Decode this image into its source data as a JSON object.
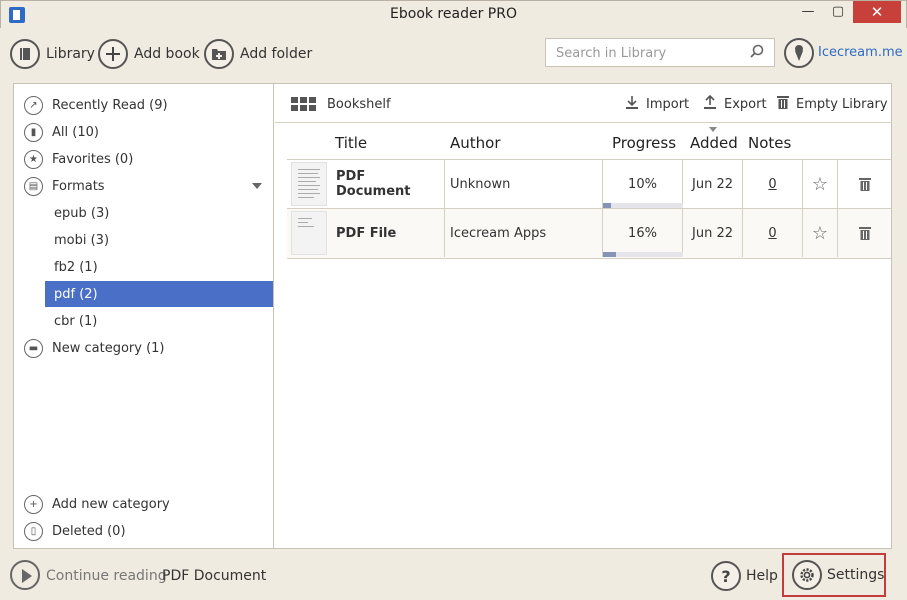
{
  "window": {
    "title": "Ebook reader PRO",
    "min_glyph": "—",
    "max_glyph": "▢",
    "close_glyph": "✕"
  },
  "toolbar": {
    "library_label": "Library",
    "add_book_label": "Add book",
    "add_folder_label": "Add folder",
    "search_placeholder": "Search in Library",
    "brand_link": "Icecream.me"
  },
  "sidebar": {
    "items": [
      {
        "label": "Recently Read (9)",
        "icon": "recently-read-icon"
      },
      {
        "label": "All (10)",
        "icon": "books-icon"
      },
      {
        "label": "Favorites (0)",
        "icon": "star-icon"
      },
      {
        "label": "Formats",
        "icon": "file-icon"
      }
    ],
    "formats": [
      {
        "label": "epub (3)"
      },
      {
        "label": "mobi (3)"
      },
      {
        "label": "fb2 (1)"
      },
      {
        "label": "pdf (2)",
        "selected": true
      },
      {
        "label": "cbr (1)"
      }
    ],
    "category": {
      "label": "New category (1)",
      "icon": "folder-icon"
    },
    "add_category": "Add new category",
    "deleted": "Deleted (0)"
  },
  "content": {
    "view_label": "Bookshelf",
    "actions": {
      "import": "Import",
      "export": "Export",
      "empty": "Empty Library"
    },
    "columns": {
      "title": "Title",
      "author": "Author",
      "progress": "Progress",
      "added": "Added",
      "notes": "Notes"
    },
    "books": [
      {
        "title": "PDF Document",
        "author": "Unknown",
        "progress": "10%",
        "progress_value": 0.1,
        "added": "Jun 22",
        "notes": "0"
      },
      {
        "title": "PDF File",
        "author": "Icecream Apps",
        "progress": "16%",
        "progress_value": 0.16,
        "added": "Jun 22",
        "notes": "0"
      }
    ]
  },
  "bottom": {
    "continue_label": "Continue reading",
    "continue_doc": "PDF Document",
    "help_label": "Help",
    "settings_label": "Settings"
  },
  "colors": {
    "accent": "#4a6fc7",
    "link": "#2f6bc4",
    "close": "#c7403a",
    "highlight_border": "#c33b3b"
  }
}
